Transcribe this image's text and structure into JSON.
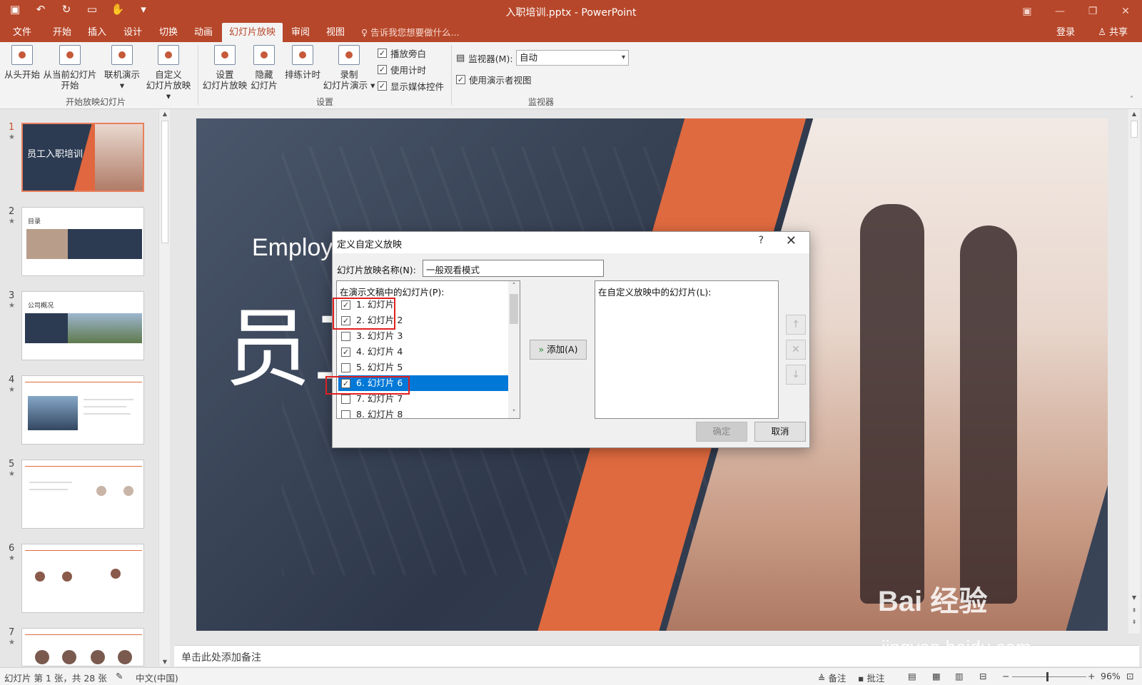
{
  "window": {
    "title": "入职培训.pptx - PowerPoint"
  },
  "menu_tabs": [
    "文件",
    "开始",
    "插入",
    "设计",
    "切换",
    "动画",
    "幻灯片放映",
    "审阅",
    "视图"
  ],
  "active_tab": "幻灯片放映",
  "tell_me": "告诉我您想要做什么...",
  "account": {
    "login": "登录",
    "share": "共享"
  },
  "ribbon": {
    "start_group": {
      "label": "开始放映幻灯片",
      "btn_from_beginning": "从头开始",
      "btn_from_current_1": "从当前幻灯片",
      "btn_from_current_2": "开始",
      "btn_online": "联机演示",
      "btn_custom_1": "自定义",
      "btn_custom_2": "幻灯片放映"
    },
    "setup_group": {
      "label": "设置",
      "btn_setup_1": "设置",
      "btn_setup_2": "幻灯片放映",
      "btn_hide_1": "隐藏",
      "btn_hide_2": "幻灯片",
      "btn_rehearse": "排练计时",
      "btn_record_1": "录制",
      "btn_record_2": "幻灯片演示",
      "chk_narration": "播放旁白",
      "chk_timings": "使用计时",
      "chk_media": "显示媒体控件"
    },
    "monitor_group": {
      "label": "监视器",
      "monitor_label": "监视器(M):",
      "monitor_value": "自动",
      "chk_presenter": "使用演示者视图"
    }
  },
  "thumbnails": [
    {
      "num": "1",
      "title": "员工入职培训"
    },
    {
      "num": "2",
      "title": "目录"
    },
    {
      "num": "3",
      "title": "公司概况"
    },
    {
      "num": "4",
      "title": ""
    },
    {
      "num": "5",
      "title": ""
    },
    {
      "num": "6",
      "title": ""
    },
    {
      "num": "7",
      "title": ""
    }
  ],
  "slide": {
    "english_title": "Employ",
    "chinese_title": "员工"
  },
  "notes_placeholder": "单击此处添加备注",
  "dialog": {
    "title": "定义自定义放映",
    "help": "?",
    "name_label": "幻灯片放映名称(N):",
    "name_value": "一般观看模式",
    "left_list_label": "在演示文稿中的幻灯片(P):",
    "right_list_label": "在自定义放映中的幻灯片(L):",
    "add_button": "添加(A)",
    "ok_button": "确定",
    "cancel_button": "取消",
    "slides": [
      {
        "label": "1. 幻灯片",
        "checked": true
      },
      {
        "label": "2. 幻灯片 2",
        "checked": true
      },
      {
        "label": "3. 幻灯片 3",
        "checked": false
      },
      {
        "label": "4. 幻灯片 4",
        "checked": true
      },
      {
        "label": "5. 幻灯片 5",
        "checked": false
      },
      {
        "label": "6. 幻灯片 6",
        "checked": true
      },
      {
        "label": "7. 幻灯片 7",
        "checked": false
      },
      {
        "label": "8. 幻灯片 8",
        "checked": false
      }
    ],
    "selected_index": 5
  },
  "status": {
    "slide_info": "幻灯片 第 1 张，共 28 张",
    "language": "中文(中国)",
    "notes": "备注",
    "comments": "批注",
    "zoom": "96%"
  },
  "watermark": {
    "line1": "Bai 经验",
    "line2": "jingyan.baidu.com"
  },
  "colors": {
    "accent": "#b7472a",
    "selection": "#0078d7",
    "highlight_box": "#e02020",
    "slide_orange": "#e06a3f"
  }
}
